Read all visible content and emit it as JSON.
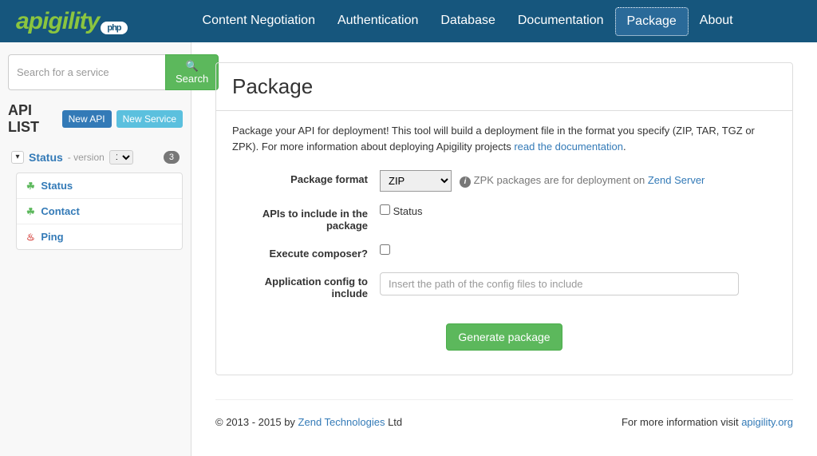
{
  "logo": {
    "text": "apigility",
    "badge": "php"
  },
  "nav": {
    "items": [
      "Content Negotiation",
      "Authentication",
      "Database",
      "Documentation",
      "Package",
      "About"
    ],
    "active": "Package"
  },
  "sidebar": {
    "search_placeholder": "Search for a service",
    "search_btn": "Search",
    "title": "API LIST",
    "new_api_btn": "New API",
    "new_service_btn": "New Service",
    "api": {
      "name": "Status",
      "version_label": " - version ",
      "version": "1",
      "badge": "3",
      "services": [
        {
          "icon": "leaf",
          "label": "Status"
        },
        {
          "icon": "leaf",
          "label": "Contact"
        },
        {
          "icon": "fire",
          "label": "Ping"
        }
      ]
    }
  },
  "main": {
    "heading": "Package",
    "intro_text": "Package your API for deployment! This tool will build a deployment file in the format you specify (ZIP, TAR, TGZ or ZPK). For more information about deploying Apigility projects ",
    "intro_link": "read the documentation",
    "intro_after": ".",
    "form": {
      "pkg_format_label": "Package format",
      "pkg_format_value": "ZIP",
      "pkg_format_help": " ZPK packages are for deployment on ",
      "pkg_format_help_link": "Zend Server",
      "apis_label": "APIs to include in the package",
      "apis_option": "Status",
      "composer_label": "Execute composer?",
      "config_label": "Application config to include",
      "config_placeholder": "Insert the path of the config files to include",
      "generate_btn": "Generate package"
    }
  },
  "footer": {
    "left_prefix": "© 2013 - 2015 by ",
    "left_link": "Zend Technologies",
    "left_suffix": " Ltd",
    "right_prefix": "For more information visit ",
    "right_link": "apigility.org"
  }
}
